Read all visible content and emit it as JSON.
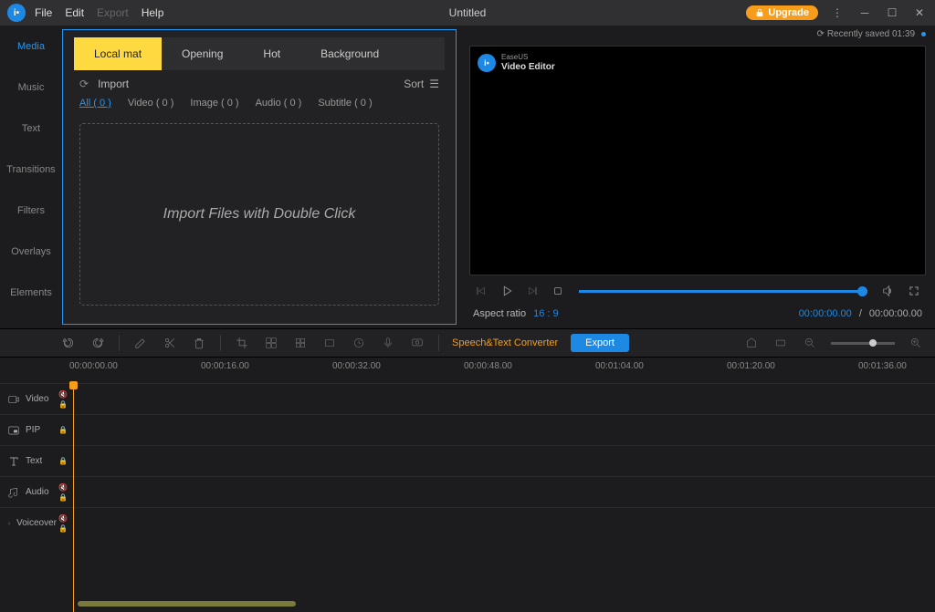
{
  "titlebar": {
    "menus": [
      "File",
      "Edit",
      "Export",
      "Help"
    ],
    "title": "Untitled",
    "upgrade": "Upgrade",
    "saved_label": "Recently saved 01:39"
  },
  "sidebar": {
    "items": [
      "Media",
      "Music",
      "Text",
      "Transitions",
      "Filters",
      "Overlays",
      "Elements"
    ]
  },
  "media": {
    "tabs": [
      "Local mat",
      "Opening",
      "Hot",
      "Background"
    ],
    "import_label": "Import",
    "sort_label": "Sort",
    "filters": [
      "All ( 0 )",
      "Video ( 0 )",
      "Image ( 0 )",
      "Audio ( 0 )",
      "Subtitle ( 0 )"
    ],
    "dropzone_text": "Import Files with Double Click"
  },
  "preview": {
    "brand_small": "EaseUS",
    "brand_big": "Video Editor",
    "aspect_label": "Aspect ratio",
    "aspect_value": "16 : 9",
    "time_current": "00:00:00.00",
    "time_sep": "/",
    "time_total": "00:00:00.00"
  },
  "toolbar": {
    "speech_text": "Speech&Text Converter",
    "export": "Export"
  },
  "timeline": {
    "marks": [
      "00:00:00.00",
      "00:00:16.00",
      "00:00:32.00",
      "00:00:48.00",
      "00:01:04.00",
      "00:01:20.00",
      "00:01:36.00"
    ],
    "tracks": [
      "Video",
      "PIP",
      "Text",
      "Audio",
      "Voiceover"
    ]
  }
}
